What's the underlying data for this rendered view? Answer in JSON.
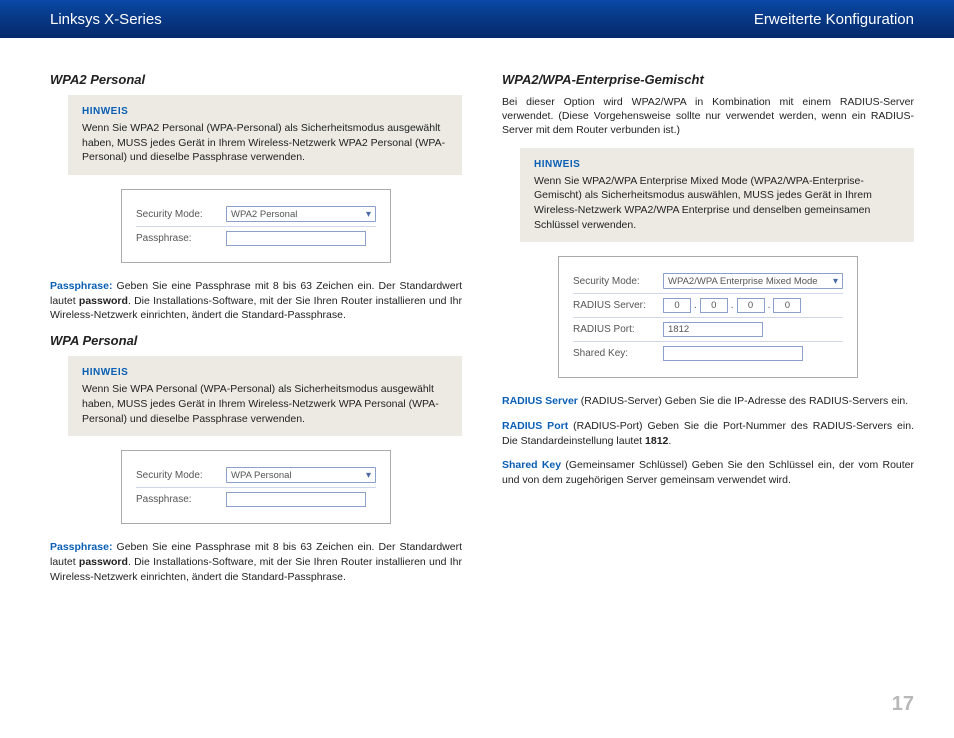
{
  "header": {
    "left": "Linksys X-Series",
    "right": "Erweiterte Konfiguration"
  },
  "left_col": {
    "wpa2p": {
      "title": "WPA2 Personal",
      "note_title": "HINWEIS",
      "note_body": "Wenn Sie WPA2 Personal (WPA-Personal) als Sicherheitsmodus ausgewählt haben, MUSS jedes Gerät in Ihrem Wireless-Netzwerk WPA2 Personal (WPA-Personal) und dieselbe Passphrase verwenden.",
      "shot": {
        "sec_label": "Security Mode:",
        "sec_value": "WPA2 Personal",
        "pass_label": "Passphrase:"
      },
      "body_key": "Passphrase:",
      "body_a": " Geben Sie eine Passphrase mit 8 bis 63 Zeichen ein. Der Standardwert lautet ",
      "body_bold": "password",
      "body_b": ". Die Installations-Software, mit der Sie Ihren Router installieren und Ihr Wireless-Netzwerk einrichten, ändert die Standard-Passphrase."
    },
    "wpap": {
      "title": "WPA Personal",
      "note_title": "HINWEIS",
      "note_body": "Wenn Sie WPA Personal (WPA-Personal) als Sicherheitsmodus ausgewählt haben, MUSS jedes Gerät in Ihrem Wireless-Netzwerk WPA Personal (WPA-Personal) und dieselbe Passphrase verwenden.",
      "shot": {
        "sec_label": "Security Mode:",
        "sec_value": "WPA Personal",
        "pass_label": "Passphrase:"
      },
      "body_key": "Passphrase:",
      "body_a": " Geben Sie eine Passphrase mit 8 bis 63 Zeichen ein. Der Standardwert lautet ",
      "body_bold": "password",
      "body_b": ". Die Installations-Software, mit der Sie Ihren Router installieren und Ihr Wireless-Netzwerk einrichten, ändert die Standard-Passphrase."
    }
  },
  "right_col": {
    "ent": {
      "title": "WPA2/WPA-Enterprise-Gemischt",
      "intro": "Bei dieser Option wird WPA2/WPA in Kombination mit einem RADIUS-Server verwendet. (Diese Vorgehensweise sollte nur verwendet werden, wenn ein RADIUS-Server mit dem Router verbunden ist.)",
      "note_title": "HINWEIS",
      "note_body": "Wenn Sie WPA2/WPA Enterprise Mixed Mode (WPA2/WPA-Enterprise-Gemischt) als Sicherheitsmodus auswählen, MUSS jedes Gerät in Ihrem Wireless-Netzwerk WPA2/WPA Enterprise und denselben gemeinsamen Schlüssel verwenden.",
      "shot": {
        "sec_label": "Security Mode:",
        "sec_value": "WPA2/WPA Enterprise Mixed Mode",
        "rserver_label": "RADIUS Server:",
        "ip0": "0",
        "ip1": "0",
        "ip2": "0",
        "ip3": "0",
        "rport_label": "RADIUS Port:",
        "rport_value": "1812",
        "skey_label": "Shared Key:"
      },
      "p1_key": "RADIUS Server",
      "p1_body": " (RADIUS-Server) Geben Sie die IP-Adresse des RADIUS-Servers ein.",
      "p2_key": "RADIUS Port",
      "p2_a": " (RADIUS-Port) Geben Sie die Port-Nummer des RADIUS-Servers ein. Die Standardeinstellung lautet ",
      "p2_bold": "1812",
      "p2_b": ".",
      "p3_key": "Shared Key",
      "p3_body": " (Gemeinsamer Schlüssel) Geben Sie den Schlüssel ein, der vom Router und von dem zugehörigen Server gemeinsam verwendet wird."
    }
  },
  "page_number": "17"
}
